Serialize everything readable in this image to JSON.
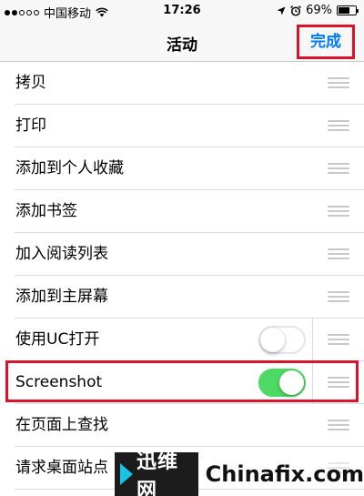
{
  "status_bar": {
    "carrier": "中国移动",
    "time": "17:26",
    "battery_percent": "69%",
    "battery_level": 0.69,
    "icons": [
      "signal-dots-icon",
      "wifi-icon",
      "location-arrow-icon",
      "alarm-icon",
      "battery-icon"
    ]
  },
  "nav": {
    "title": "活动",
    "done_label": "完成"
  },
  "rows": [
    {
      "label": "拷贝"
    },
    {
      "label": "打印"
    },
    {
      "label": "添加到个人收藏"
    },
    {
      "label": "添加书签"
    },
    {
      "label": "加入阅读列表"
    },
    {
      "label": "添加到主屏幕"
    },
    {
      "label": "使用UC打开",
      "toggle": "off"
    },
    {
      "label": "Screenshot",
      "toggle": "on"
    },
    {
      "label": "在页面上查找"
    },
    {
      "label": "请求桌面站点"
    }
  ],
  "watermark": {
    "logo_text": "迅维网",
    "site_text": "Chinafix.com"
  },
  "colors": {
    "accent": "#007aff",
    "toggle_on": "#4cd964",
    "highlight": "#d9142b"
  }
}
